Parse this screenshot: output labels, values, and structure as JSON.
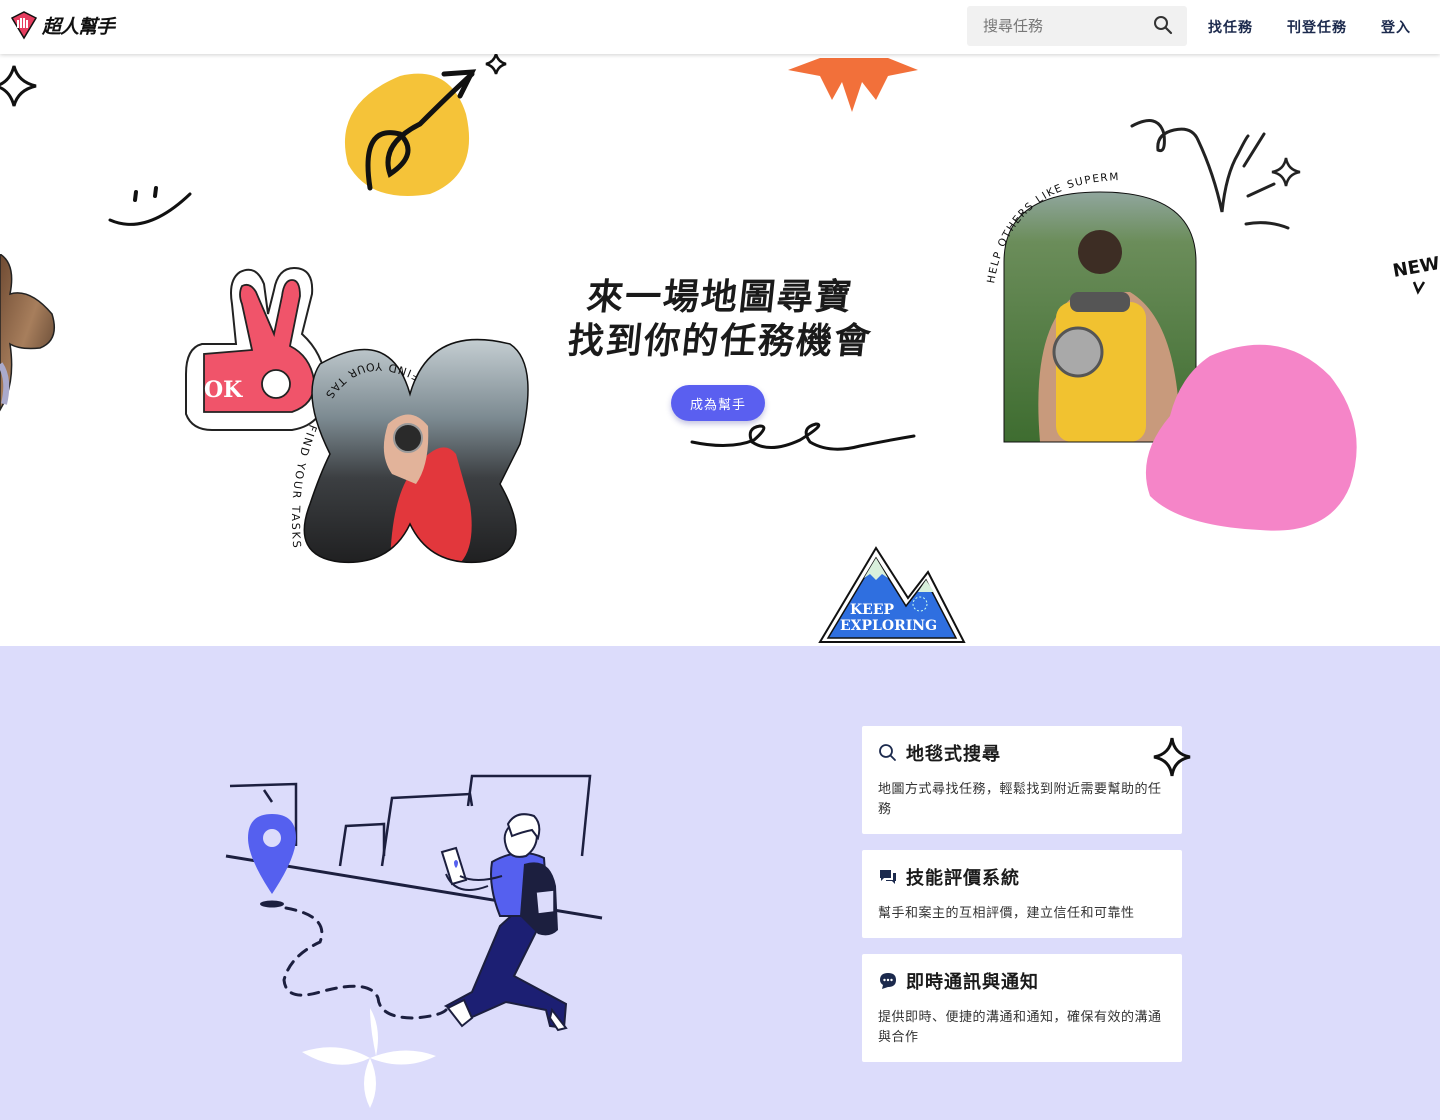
{
  "brand": {
    "name": "超人幫手",
    "accent": "#e63d5f"
  },
  "search": {
    "placeholder": "搜尋任務",
    "icon": "search-icon"
  },
  "nav": {
    "links": [
      {
        "label": "找任務"
      },
      {
        "label": "刊登任務"
      },
      {
        "label": "登入"
      }
    ]
  },
  "hero": {
    "title_line1": "來一場地圖尋寶",
    "title_line2": "找到你的任務機會",
    "cta_label": "成為幫手",
    "cta_color": "#5a5ff0",
    "stickers": {
      "ok": "OK",
      "find_task_arc": "FIND YOUR TASK",
      "tasks_now_arc": "FIND YOUR TASKS NOW",
      "superman_arc": "HELP OTHERS LIKE SUPERMAN",
      "new_doodle": "NEW",
      "keep": "KEEP",
      "exploring": "EXPLORING"
    }
  },
  "features": {
    "background": "#dcdcfb",
    "cards": [
      {
        "icon": "search-icon",
        "title": "地毯式搜尋",
        "desc": "地圖方式尋找任務，輕鬆找到附近需要幫助的任務"
      },
      {
        "icon": "review-icon",
        "title": "技能評價系統",
        "desc": "幫手和案主的互相評價，建立信任和可靠性"
      },
      {
        "icon": "chat-icon",
        "title": "即時通訊與通知",
        "desc": "提供即時、便捷的溝通和通知，確保有效的溝通與合作"
      }
    ]
  }
}
